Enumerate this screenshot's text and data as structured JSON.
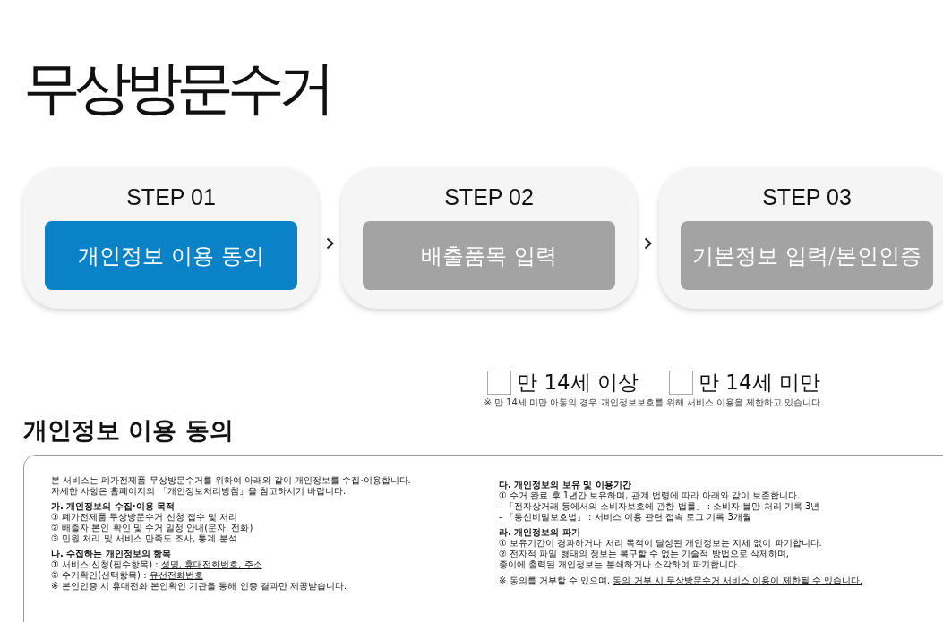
{
  "page_title": "무상방문수거",
  "steps": [
    {
      "label": "STEP 01",
      "title": "개인정보 이용 동의",
      "selected": true
    },
    {
      "label": "STEP 02",
      "title": "배출품목 입력",
      "selected": false
    },
    {
      "label": "STEP 03",
      "title": "기본정보 입력/본인인증",
      "selected": false
    }
  ],
  "age_options": [
    {
      "label": "만 14세 이상",
      "checked": false
    },
    {
      "label": "만 14세 미만",
      "checked": false
    }
  ],
  "age_note": "※ 만 14세 미만 아동의 경우 개인정보보호를 위해 서비스 이용을 제한하고 있습니다.",
  "consent": {
    "title": "개인정보 이용 동의",
    "intro": [
      "본 서비스는 폐가전제품 무상방문수거를 위하여 아래와 같이 개인정보를 수집·이용합니다.",
      "자세한 사항은 홈페이지의 「개인정보처리방침」을 참고하시기 바랍니다."
    ],
    "sections": [
      {
        "heading": "가. 개인정보의 수집·이용 목적",
        "items": [
          {
            "text": "① 폐가전제품 무상방문수거 신청 접수 및 처리"
          },
          {
            "text": "② 배출자 본인 확인 및 수거 일정 안내(문자, 전화)"
          },
          {
            "text": "③ 민원 처리 및 서비스 만족도 조사, 통계 분석"
          }
        ]
      },
      {
        "heading": "나. 수집하는 개인정보의 항목",
        "items": [
          {
            "text": "① 서비스 신청(필수항목) : ",
            "underlined": "성명, 휴대전화번호, 주소"
          },
          {
            "text": "② 수거확인(선택항목) : ",
            "underlined": "유선전화번호"
          },
          {
            "text": "※ 본인인증 시 휴대전화 본인확인 기관을 통해 인증 결과만 제공받습니다."
          }
        ]
      },
      {
        "heading": "다. 개인정보의 보유 및 이용기간",
        "items": [
          {
            "text": "① 수거 완료 후 1년간 보유하며, 관계 법령에 따라 아래와 같이 보존합니다."
          },
          {
            "text": "- 「전자상거래 등에서의 소비자보호에 관한 법률」 : 소비자 불만 처리 기록 3년"
          },
          {
            "text": "- 「통신비밀보호법」 : 서비스 이용 관련 접속 로그 기록 3개월"
          }
        ]
      },
      {
        "heading": "라. 개인정보의 파기",
        "items": [
          {
            "text": "① 보유기간이 경과하거나 처리 목적이 달성된 개인정보는 지체 없이 파기합니다."
          },
          {
            "text": "② 전자적 파일 형태의 정보는 복구할 수 없는 기술적 방법으로 삭제하며,"
          },
          {
            "text": "종이에 출력된 개인정보는 분쇄하거나 소각하여 파기합니다."
          }
        ]
      }
    ],
    "footnote": {
      "text": "※ 동의를 거부할 수 있으며, ",
      "underlined": "동의 거부 시 무상방문수거 서비스 이용이 제한될 수 있습니다."
    }
  }
}
